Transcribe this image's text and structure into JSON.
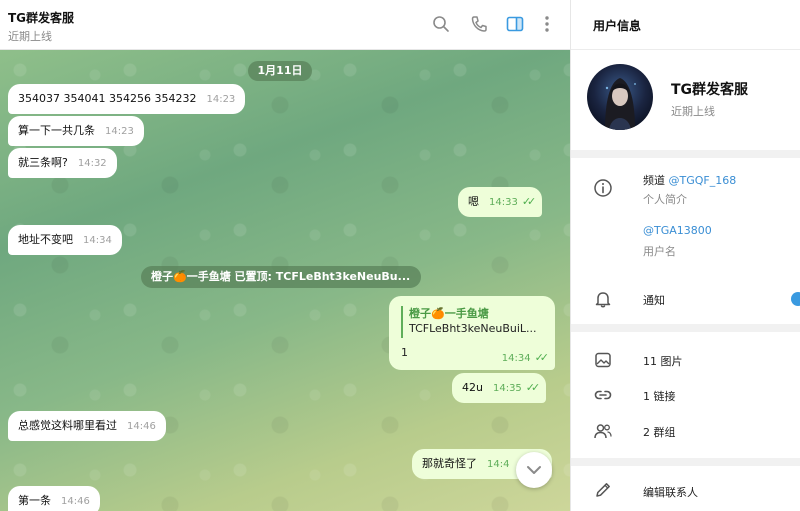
{
  "chat": {
    "title": "TG群发客服",
    "status": "近期上线",
    "date": "1月11日",
    "messages": [
      {
        "text": "354037 354041 354256 354232",
        "time": "14:23"
      },
      {
        "text": "算一下一共几条",
        "time": "14:23"
      },
      {
        "text": "就三条啊?",
        "time": "14:32"
      },
      {
        "text": "嗯",
        "time": "14:33"
      },
      {
        "text": "地址不变吧",
        "time": "14:34"
      },
      {
        "text": "42u",
        "time": "14:35"
      },
      {
        "text": "总感觉这料哪里看过",
        "time": "14:46"
      },
      {
        "text": "那就奇怪了",
        "time": "14:4"
      },
      {
        "text": "第一条",
        "time": "14:46"
      }
    ],
    "pinned": "橙子🍊一手鱼塘 已置顶: TCFLeBht3keNeuBu...",
    "reply": {
      "name": "橙子🍊一手鱼塘",
      "quote": "TCFLeBht3keNeuBuiL...",
      "body": "1",
      "time": "14:34"
    }
  },
  "icons": {
    "search": "search-icon",
    "call": "phone-icon",
    "sidebar": "sidebar-toggle-icon",
    "more": "more-vertical-icon",
    "scroll": "chevron-down-icon"
  },
  "info": {
    "title": "用户信息",
    "name": "TG群发客服",
    "status": "近期上线",
    "bio_prefix": "频道 ",
    "bio_link": "@TGQF_168",
    "bio_label": "个人简介",
    "username": "@TGA13800",
    "username_label": "用户名",
    "notify": "通知",
    "photos": "11 图片",
    "links": "1 链接",
    "groups": "2 群组",
    "edit": "编辑联系人"
  },
  "colors": {
    "accent": "#3a9ae0",
    "outgoing": "#eefed9",
    "check": "#4fae4e",
    "link": "#3a8ed4"
  }
}
